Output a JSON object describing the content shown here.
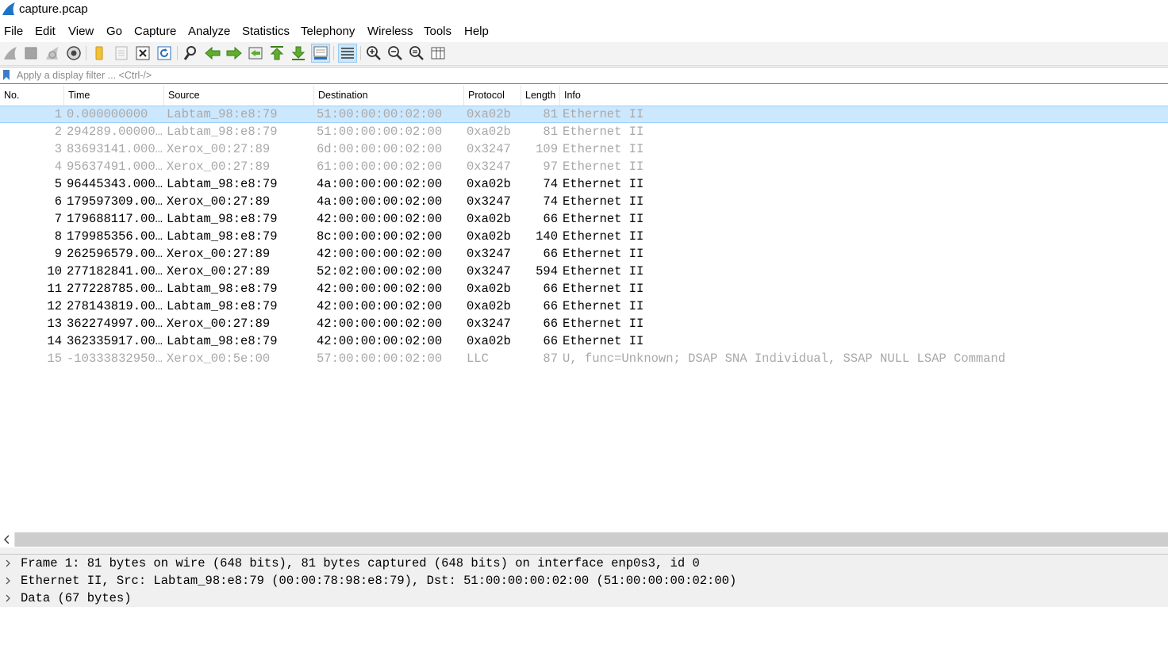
{
  "window": {
    "title": "capture.pcap"
  },
  "menu": [
    "File",
    "Edit",
    "View",
    "Go",
    "Capture",
    "Analyze",
    "Statistics",
    "Telephony",
    "Wireless",
    "Tools",
    "Help"
  ],
  "toolbar": {
    "buttons": [
      "start-capture-icon",
      "stop-capture-icon",
      "restart-capture-icon",
      "capture-options-icon",
      "open-file-icon",
      "save-file-icon",
      "close-file-icon",
      "reload-file-icon",
      "find-packet-icon",
      "go-back-icon",
      "go-forward-icon",
      "go-to-packet-icon",
      "first-packet-icon",
      "last-packet-icon",
      "auto-scroll-icon",
      "colorize-icon",
      "zoom-in-icon",
      "zoom-out-icon",
      "normal-size-icon",
      "resize-columns-icon"
    ]
  },
  "filter": {
    "placeholder": "Apply a display filter ... <Ctrl-/>",
    "value": ""
  },
  "columns": [
    "No.",
    "Time",
    "Source",
    "Destination",
    "Protocol",
    "Length",
    "Info"
  ],
  "packets": [
    {
      "no": "1",
      "time": "0.000000000",
      "src": "Labtam_98:e8:79",
      "dst": "51:00:00:00:02:00",
      "proto": "0xa02b",
      "len": "81",
      "info": "Ethernet II"
    },
    {
      "no": "2",
      "time": "294289.00000…",
      "src": "Labtam_98:e8:79",
      "dst": "51:00:00:00:02:00",
      "proto": "0xa02b",
      "len": "81",
      "info": "Ethernet II"
    },
    {
      "no": "3",
      "time": "83693141.000…",
      "src": "Xerox_00:27:89",
      "dst": "6d:00:00:00:02:00",
      "proto": "0x3247",
      "len": "109",
      "info": "Ethernet II"
    },
    {
      "no": "4",
      "time": "95637491.000…",
      "src": "Xerox_00:27:89",
      "dst": "61:00:00:00:02:00",
      "proto": "0x3247",
      "len": "97",
      "info": "Ethernet II"
    },
    {
      "no": "5",
      "time": "96445343.000…",
      "src": "Labtam_98:e8:79",
      "dst": "4a:00:00:00:02:00",
      "proto": "0xa02b",
      "len": "74",
      "info": "Ethernet II"
    },
    {
      "no": "6",
      "time": "179597309.00…",
      "src": "Xerox_00:27:89",
      "dst": "4a:00:00:00:02:00",
      "proto": "0x3247",
      "len": "74",
      "info": "Ethernet II"
    },
    {
      "no": "7",
      "time": "179688117.00…",
      "src": "Labtam_98:e8:79",
      "dst": "42:00:00:00:02:00",
      "proto": "0xa02b",
      "len": "66",
      "info": "Ethernet II"
    },
    {
      "no": "8",
      "time": "179985356.00…",
      "src": "Labtam_98:e8:79",
      "dst": "8c:00:00:00:02:00",
      "proto": "0xa02b",
      "len": "140",
      "info": "Ethernet II"
    },
    {
      "no": "9",
      "time": "262596579.00…",
      "src": "Xerox_00:27:89",
      "dst": "42:00:00:00:02:00",
      "proto": "0x3247",
      "len": "66",
      "info": "Ethernet II"
    },
    {
      "no": "10",
      "time": "277182841.00…",
      "src": "Xerox_00:27:89",
      "dst": "52:02:00:00:02:00",
      "proto": "0x3247",
      "len": "594",
      "info": "Ethernet II"
    },
    {
      "no": "11",
      "time": "277228785.00…",
      "src": "Labtam_98:e8:79",
      "dst": "42:00:00:00:02:00",
      "proto": "0xa02b",
      "len": "66",
      "info": "Ethernet II"
    },
    {
      "no": "12",
      "time": "278143819.00…",
      "src": "Labtam_98:e8:79",
      "dst": "42:00:00:00:02:00",
      "proto": "0xa02b",
      "len": "66",
      "info": "Ethernet II"
    },
    {
      "no": "13",
      "time": "362274997.00…",
      "src": "Xerox_00:27:89",
      "dst": "42:00:00:00:02:00",
      "proto": "0x3247",
      "len": "66",
      "info": "Ethernet II"
    },
    {
      "no": "14",
      "time": "362335917.00…",
      "src": "Labtam_98:e8:79",
      "dst": "42:00:00:00:02:00",
      "proto": "0xa02b",
      "len": "66",
      "info": "Ethernet II"
    },
    {
      "no": "15",
      "time": "-10333832950…",
      "src": "Xerox_00:5e:00",
      "dst": "57:00:00:00:02:00",
      "proto": "LLC",
      "len": "87",
      "info": "U, func=Unknown; DSAP SNA Individual, SSAP NULL LSAP Command"
    }
  ],
  "selected_packet": "1",
  "dimmed_packets": [
    "1",
    "2",
    "3",
    "4",
    "15"
  ],
  "details": [
    "Frame 1: 81 bytes on wire (648 bits), 81 bytes captured (648 bits) on interface enp0s3, id 0",
    "Ethernet II, Src: Labtam_98:e8:79 (00:00:78:98:e8:79), Dst: 51:00:00:00:02:00 (51:00:00:00:02:00)",
    "Data (67 bytes)"
  ],
  "colors": {
    "selection": "#cce8ff",
    "dimmed_text": "#a8a8a8",
    "toolbar_bg": "#f3f3f3",
    "details_bg": "#f0f0f0",
    "accent": "#1e73c8"
  }
}
